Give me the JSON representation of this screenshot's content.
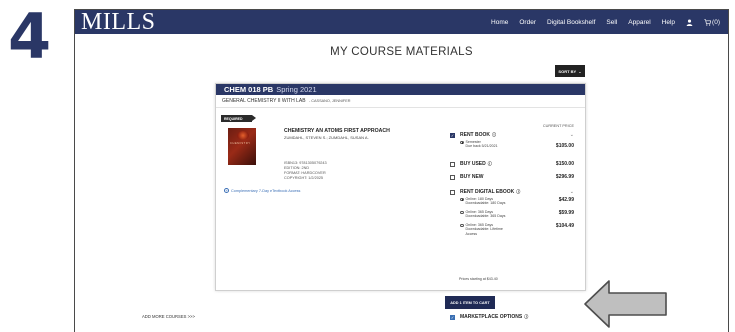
{
  "step_number": "4",
  "header": {
    "logo": "MILLS",
    "nav": [
      "Home",
      "Order",
      "Digital Bookshelf",
      "Sell",
      "Apparel",
      "Help"
    ],
    "cart_label": "(0)"
  },
  "page": {
    "title": "MY COURSE MATERIALS",
    "sort_label": "SORT BY"
  },
  "course": {
    "code": "CHEM 018 PB",
    "term": "Spring 2021",
    "name": "GENERAL CHEMISTRY II WITH LAB",
    "instructor": "- CASSANO, JENNIFER"
  },
  "book": {
    "tag": "REQUIRED",
    "cover_text": "CHEMISTRY",
    "title": "CHEMISTRY AN ATOMS FIRST APPROACH",
    "authors": "ZUMDAHL, STEVEN S.; ZUMDAHL, SUSAN A.",
    "isbn": "ISBN13: 9781305079243",
    "edition": "EDITION: 2ND",
    "format": "FORMAT: HARDCOVER",
    "copyright": "COPYRIGHT: 1/2/2025",
    "ebook_link": "Complementary 7-Day eTextbook Access"
  },
  "options": {
    "current_price_label": "CURRENT PRICE",
    "rent_book": {
      "label": "RENT BOOK",
      "sub": [
        {
          "line1": "Semester",
          "line2": "Due back 5/21/2021",
          "price": "$105.00"
        }
      ]
    },
    "buy_used": {
      "label": "BUY USED",
      "price": "$150.00"
    },
    "buy_new": {
      "label": "BUY NEW",
      "price": "$296.99"
    },
    "rent_digital": {
      "label": "RENT DIGITAL EBOOK",
      "sub": [
        {
          "line1": "Online: 180 Days",
          "line2": "Downloadable: 180 Days",
          "price": "$42.99"
        },
        {
          "line1": "Online: 365 Days",
          "line2": "Downloadable: 365 Days",
          "price": "$59.99"
        },
        {
          "line1": "Online: 365 Days",
          "line2": "Downloadable: Lifetime",
          "line3": "Access",
          "price": "$104.49"
        }
      ]
    },
    "marketplace": {
      "label": "MARKETPLACE OPTIONS",
      "sub": "Prices starting at $43.40"
    }
  },
  "actions": {
    "add_to_cart": "ADD 1 ITEM TO CART",
    "add_more": "ADD MORE COURSES >>>"
  },
  "colors": {
    "brand": "#2a3766",
    "link": "#3b6fb6",
    "arrow": "#bfbfbf"
  }
}
